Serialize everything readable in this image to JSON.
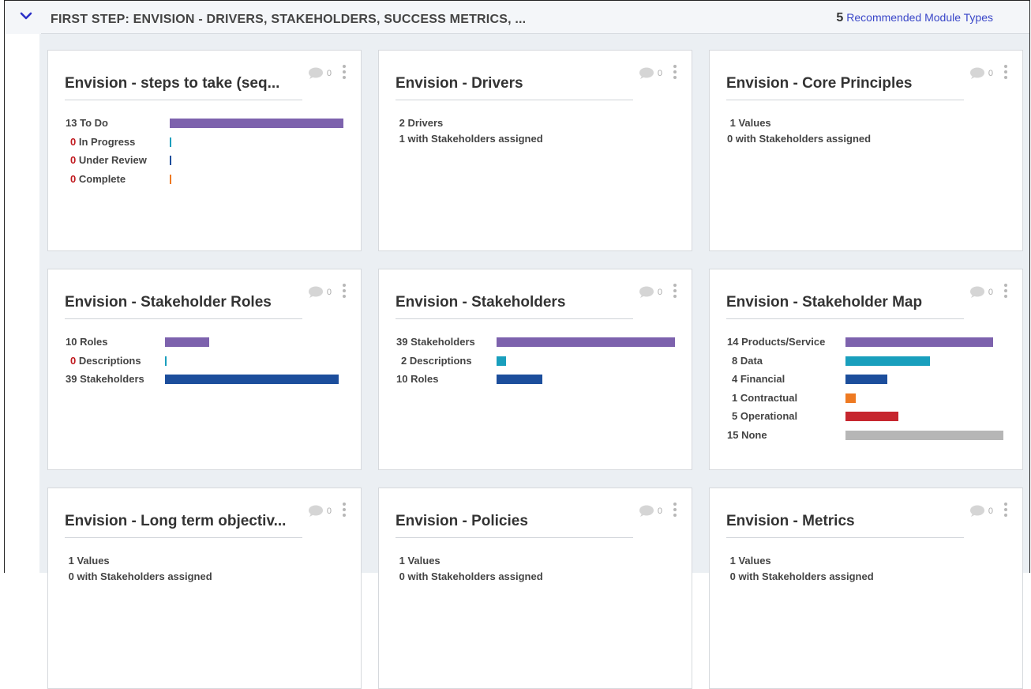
{
  "section": {
    "title": "FIRST STEP: ENVISION - DRIVERS, STAKEHOLDERS, SUCCESS METRICS, ...",
    "recommended_count": "5",
    "recommended_label": "Recommended Module Types"
  },
  "colors": {
    "purple": "#7d62ad",
    "teal": "#199fbd",
    "navy": "#1c4e9c",
    "orange": "#ee7a22",
    "red": "#c6262e",
    "gray": "#b6b6b6",
    "count_red": "#c0191e"
  },
  "cards": [
    {
      "title": "Envision - steps to take (seq...",
      "comments": "0",
      "rows": [
        {
          "count": "13",
          "label": "To Do",
          "red": false,
          "value": 13,
          "color": "purple"
        },
        {
          "count": "0",
          "label": "In Progress",
          "red": true,
          "value": 0,
          "color": "teal"
        },
        {
          "count": "0",
          "label": "Under Review",
          "red": true,
          "value": 0,
          "color": "navy"
        },
        {
          "count": "0",
          "label": "Complete",
          "red": true,
          "value": 0,
          "color": "orange"
        }
      ]
    },
    {
      "title": "Envision - Drivers",
      "comments": "0",
      "lines": [
        " 2 Drivers",
        " 1 with Stakeholders assigned"
      ]
    },
    {
      "title": "Envision - Core Principles",
      "comments": "0",
      "lines": [
        " 1 Values",
        "0 with Stakeholders assigned"
      ]
    },
    {
      "title": "Envision - Stakeholder Roles",
      "comments": "0",
      "rows": [
        {
          "count": "10",
          "label": "Roles",
          "red": false,
          "value": 10,
          "color": "purple"
        },
        {
          "count": "0",
          "label": "Descriptions",
          "red": true,
          "value": 0,
          "color": "teal"
        },
        {
          "count": "39",
          "label": "Stakeholders",
          "red": false,
          "value": 39,
          "color": "navy"
        }
      ]
    },
    {
      "title": "Envision - Stakeholders",
      "comments": "0",
      "rows": [
        {
          "count": "39",
          "label": "Stakeholders",
          "red": false,
          "value": 39,
          "color": "purple"
        },
        {
          "count": "2",
          "label": "Descriptions",
          "red": false,
          "value": 2,
          "color": "teal"
        },
        {
          "count": "10",
          "label": "Roles",
          "red": false,
          "value": 10,
          "color": "navy"
        }
      ]
    },
    {
      "title": "Envision - Stakeholder Map",
      "comments": "0",
      "rows": [
        {
          "count": "14",
          "label": "Products/Service",
          "red": false,
          "value": 14,
          "color": "purple"
        },
        {
          "count": "8",
          "label": "Data",
          "red": false,
          "value": 8,
          "color": "teal"
        },
        {
          "count": "4",
          "label": "Financial",
          "red": false,
          "value": 4,
          "color": "navy"
        },
        {
          "count": "1",
          "label": "Contractual",
          "red": false,
          "value": 1,
          "color": "orange"
        },
        {
          "count": "5",
          "label": "Operational",
          "red": false,
          "value": 5,
          "color": "red"
        },
        {
          "count": "15",
          "label": "None",
          "red": false,
          "value": 15,
          "color": "gray"
        }
      ]
    },
    {
      "title": "Envision - Long term objectiv...",
      "comments": "0",
      "lines": [
        " 1 Values",
        " 0 with Stakeholders assigned"
      ]
    },
    {
      "title": "Envision - Policies",
      "comments": "0",
      "lines": [
        " 1 Values",
        " 0 with Stakeholders assigned"
      ]
    },
    {
      "title": "Envision - Metrics",
      "comments": "0",
      "lines": [
        " 1 Values",
        " 0 with Stakeholders assigned"
      ]
    }
  ]
}
